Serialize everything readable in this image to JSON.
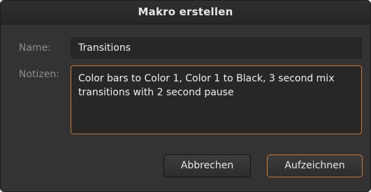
{
  "dialog": {
    "title": "Makro erstellen"
  },
  "form": {
    "name_label": "Name:",
    "name_value": "Transitions",
    "notes_label": "Notizen:",
    "notes_value": "Color bars to Color 1, Color 1 to Black, 3 second mix transitions with 2 second pause"
  },
  "buttons": {
    "cancel_label": "Abbrechen",
    "record_label": "Aufzeichnen"
  },
  "colors": {
    "background": "#333333",
    "titlebar": "#262626",
    "field_background": "#272727",
    "focus_accent": "#d07a2e",
    "label_text": "#8c8c8c",
    "value_text": "#f0f0f0"
  }
}
